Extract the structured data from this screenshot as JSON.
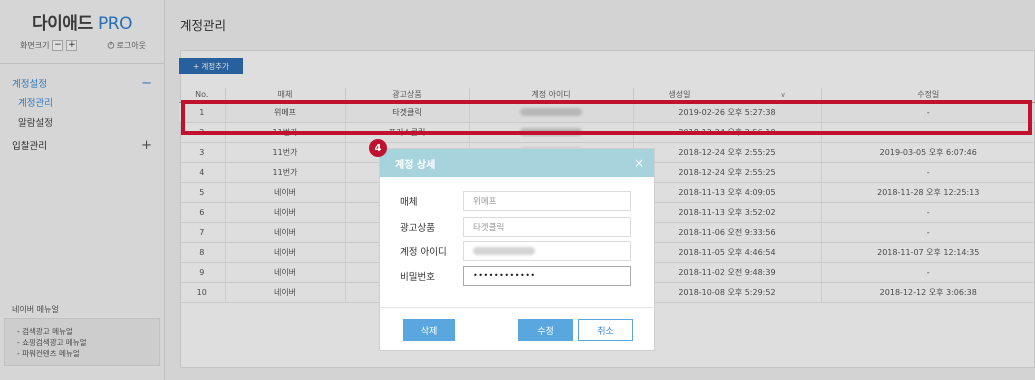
{
  "sidebar": {
    "logo_main": "다이애드",
    "logo_pro": "PRO",
    "zoom_label": "화면크기",
    "zoom_minus": "−",
    "zoom_plus": "+",
    "logout_label": "로그아웃",
    "menu": [
      {
        "label": "계정설정",
        "sign": "−"
      },
      {
        "label": "입찰관리",
        "sign": "+"
      }
    ],
    "submenu": [
      {
        "label": "계정관리"
      },
      {
        "label": "알람설정"
      }
    ],
    "manual_title": "네이버 메뉴얼",
    "manual_items": [
      "- 검색광고 메뉴얼",
      "- 쇼핑검색광고 메뉴얼",
      "- 파워컨텐츠 메뉴얼"
    ]
  },
  "main": {
    "title": "계정관리",
    "add_button": "계정추가",
    "columns": [
      "No.",
      "매체",
      "광고상품",
      "계정 아이디",
      "생성일",
      "수정일"
    ],
    "rows": [
      {
        "no": "1",
        "media": "위메프",
        "product": "타겟클릭",
        "created": "2019-02-26 오후 5:27:38",
        "modified": "-"
      },
      {
        "no": "2",
        "media": "11번가",
        "product": "포커스클릭",
        "created": "2018-12-24 오후 2:56:10",
        "modified": "-"
      },
      {
        "no": "3",
        "media": "11번가",
        "product": "",
        "created": "2018-12-24 오후 2:55:25",
        "modified": "2019-03-05 오후 6:07:46"
      },
      {
        "no": "4",
        "media": "11번가",
        "product": "",
        "created": "2018-12-24 오후 2:55:25",
        "modified": "-"
      },
      {
        "no": "5",
        "media": "네이버",
        "product": "",
        "created": "2018-11-13 오후 4:09:05",
        "modified": "2018-11-28 오후 12:25:13"
      },
      {
        "no": "6",
        "media": "네이버",
        "product": "",
        "created": "2018-11-13 오후 3:52:02",
        "modified": "-"
      },
      {
        "no": "7",
        "media": "네이버",
        "product": "",
        "created": "2018-11-06 오전 9:33:56",
        "modified": "-"
      },
      {
        "no": "8",
        "media": "네이버",
        "product": "",
        "created": "2018-11-05 오후 4:46:54",
        "modified": "2018-11-07 오후 12:14:35"
      },
      {
        "no": "9",
        "media": "네이버",
        "product": "",
        "created": "2018-11-02 오전 9:48:39",
        "modified": "-"
      },
      {
        "no": "10",
        "media": "네이버",
        "product": "",
        "created": "2018-10-08 오후 5:29:52",
        "modified": "2018-12-12 오후 3:06:38"
      }
    ]
  },
  "step_badge": "4",
  "modal": {
    "title": "계정 상세",
    "close": "×",
    "fields": {
      "media_label": "매체",
      "media_value": "위메프",
      "product_label": "광고상품",
      "product_value": "타겟클릭",
      "id_label": "계정 아이디",
      "password_label": "비밀번호",
      "password_value": "••••••••••••"
    },
    "delete_button": "삭제",
    "edit_button": "수정",
    "cancel_button": "취소"
  },
  "colors": {
    "accent": "#3a8bd8",
    "button_blue": "#2e6fb5",
    "highlight_red": "#c0122f",
    "modal_header": "#a7d3dd"
  }
}
